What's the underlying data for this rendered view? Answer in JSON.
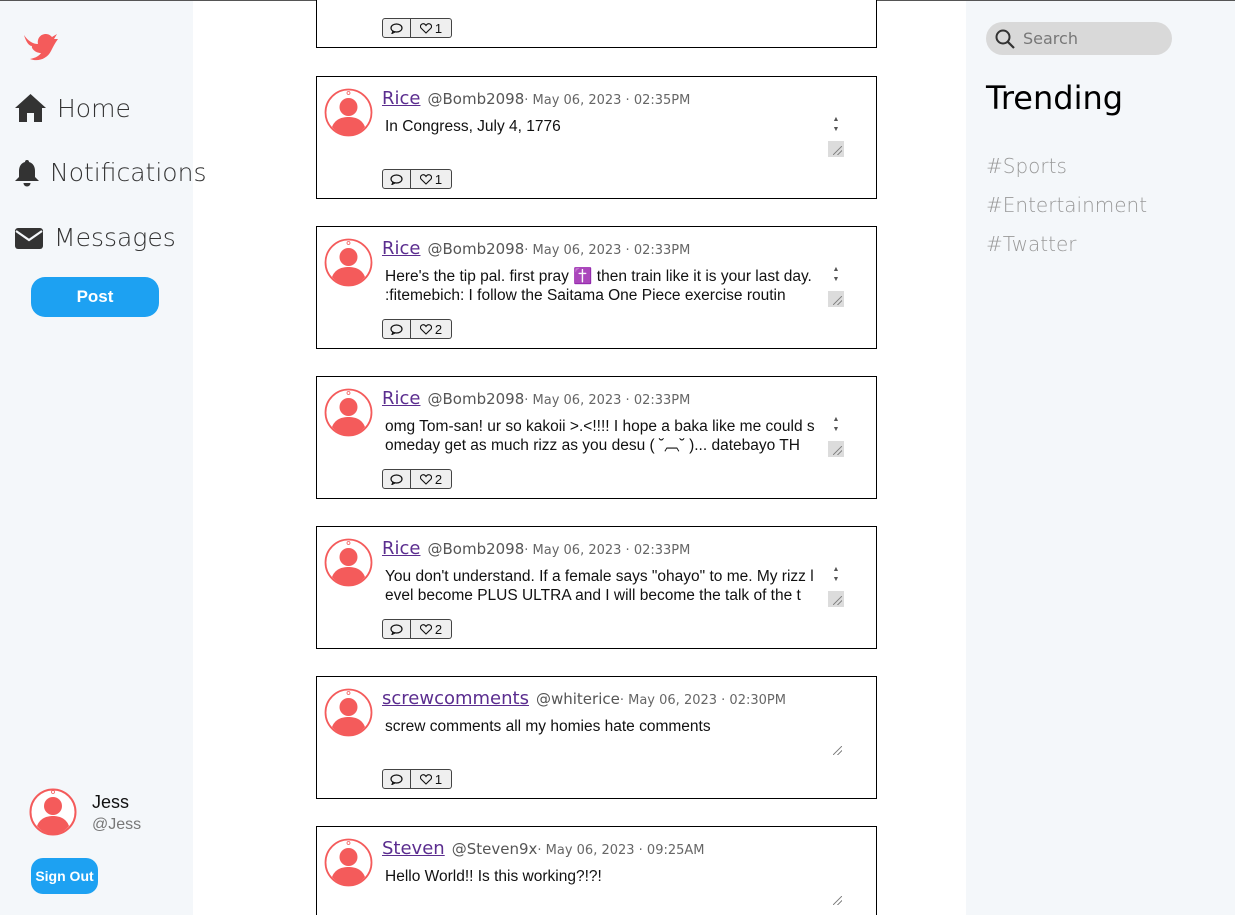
{
  "nav": {
    "items": [
      {
        "label": "Home",
        "icon": "home-icon"
      },
      {
        "label": "Notifications",
        "icon": "bell-icon"
      },
      {
        "label": "Messages",
        "icon": "envelope-icon"
      }
    ],
    "post_label": "Post"
  },
  "user": {
    "name": "Jess",
    "handle": "@Jess",
    "signout_label": "Sign Out"
  },
  "search": {
    "placeholder": "Search"
  },
  "trending": {
    "title": "Trending",
    "items": [
      "#Sports",
      "#Entertainment",
      "#Twatter"
    ]
  },
  "colors": {
    "brand_red": "#f45b5b",
    "accent_blue": "#1da1f2",
    "link_purple": "#5b2d8f"
  },
  "posts": [
    {
      "name": "",
      "handle": "",
      "date": "",
      "text": "",
      "likes": "1"
    },
    {
      "name": "Rice",
      "handle": "@Bomb2098",
      "date": " · May 06, 2023 · 02:35PM",
      "text": "In Congress, July 4, 1776",
      "likes": "1"
    },
    {
      "name": "Rice",
      "handle": "@Bomb2098",
      "date": " · May 06, 2023 · 02:33PM",
      "text": "Here's the tip pal. first pray ✝️ then train like it is your last day. :fitemebich:  I follow the Saitama One Piece exercise routin",
      "likes": "2"
    },
    {
      "name": "Rice",
      "handle": "@Bomb2098",
      "date": " · May 06, 2023 · 02:33PM",
      "text": "omg Tom-san! ur so kakoii >.<!!!! I hope a baka like me could someday get as much rizz as you desu ( ˘︹˘ )... datebayo TH",
      "likes": "2"
    },
    {
      "name": "Rice",
      "handle": "@Bomb2098",
      "date": " · May 06, 2023 · 02:33PM",
      "text": "You don't understand. If a female says \"ohayo\" to me. My rizz level become PLUS ULTRA and I will become the talk of the t",
      "likes": "2"
    },
    {
      "name": "screwcomments",
      "handle": "@whiterice",
      "date": " · May 06, 2023 · 02:30PM",
      "text": "screw comments all my homies hate comments",
      "likes": "1"
    },
    {
      "name": "Steven",
      "handle": "@Steven9x",
      "date": " · May 06, 2023 · 09:25AM",
      "text": "Hello World!! Is this working?!?!",
      "likes": ""
    }
  ]
}
